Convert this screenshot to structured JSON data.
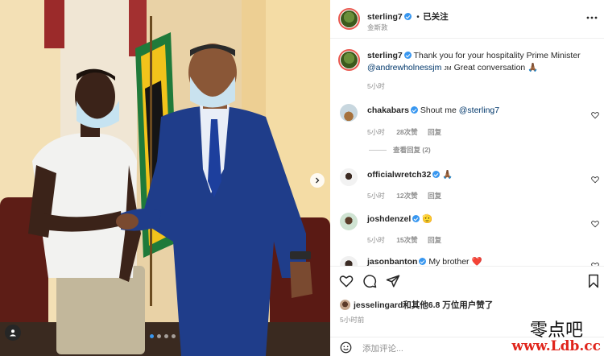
{
  "post": {
    "author": "sterling7",
    "follow_status": "已关注",
    "location": "金斯敦",
    "more_icon": "more-horizontal-icon"
  },
  "caption": {
    "username": "sterling7",
    "text": "Thank you for your hospitality Prime Minister",
    "mention": "@andrewholnessjm",
    "flag": "JM",
    "text2": "Great conversation",
    "emoji": "🙏🏾",
    "time": "5小时"
  },
  "comments": [
    {
      "username": "chakabars",
      "text": "Shout me",
      "mention": "@sterling7",
      "time": "5小时",
      "likes": "28次赞",
      "reply": "回复",
      "view_replies": "查看回复 (2)"
    },
    {
      "username": "officialwretch32",
      "text": "🙏🏾",
      "time": "5小时",
      "likes": "12次赞",
      "reply": "回复"
    },
    {
      "username": "joshdenzel",
      "text": "🫡",
      "time": "5小时",
      "likes": "15次赞",
      "reply": "回复"
    },
    {
      "username": "jasonbanton",
      "text": "My brother",
      "emoji": "❤️"
    }
  ],
  "likes_summary": "jesselingard和其他6.8 万位用户赞了",
  "post_time": "5小时前",
  "add_comment_placeholder": "添加评论...",
  "watermark": {
    "title": "零点吧",
    "url": "www.Ldb.cc"
  },
  "colors": {
    "verified": "#3897f0",
    "link": "#00376b",
    "muted": "#8e8e8e",
    "watermark_red": "#e0241b"
  }
}
